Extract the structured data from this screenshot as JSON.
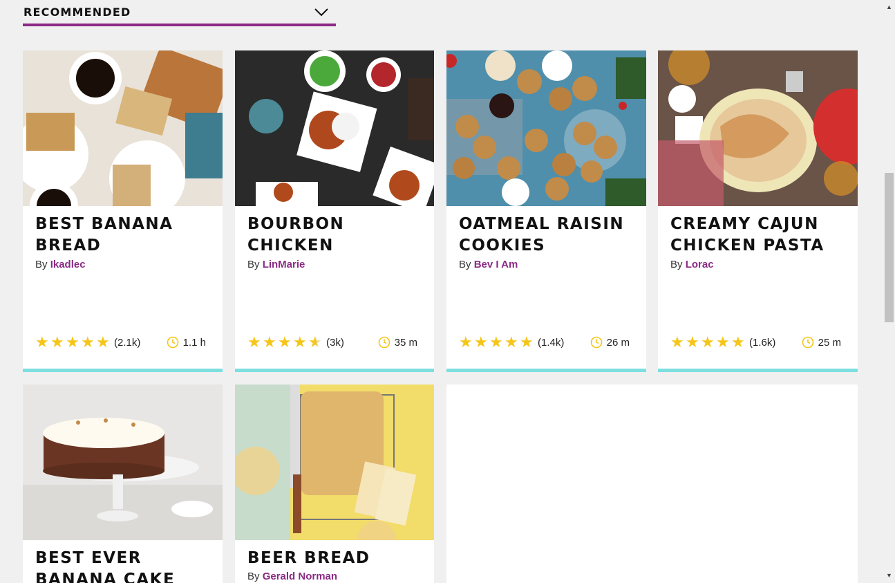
{
  "sort": {
    "label": "RECOMMENDED"
  },
  "by_prefix": "By",
  "recipes": [
    {
      "title": "BEST BANANA BREAD",
      "author": "Ikadlec",
      "rating_value": 5,
      "rating_count": "(2.1k)",
      "time": "1.1 h"
    },
    {
      "title": "BOURBON CHICKEN",
      "author": "LinMarie",
      "rating_value": 4.5,
      "rating_count": "(3k)",
      "time": "35 m"
    },
    {
      "title": "OATMEAL RAISIN COOKIES",
      "author": "Bev I Am",
      "rating_value": 5,
      "rating_count": "(1.4k)",
      "time": "26 m"
    },
    {
      "title": "CREAMY CAJUN CHICKEN PASTA",
      "author": "Lorac",
      "rating_value": 5,
      "rating_count": "(1.6k)",
      "time": "25 m"
    },
    {
      "title": "BEST EVER BANANA CAKE WITH CREAM",
      "author": ""
    },
    {
      "title": "BEER BREAD",
      "author": "Gerald Norman"
    }
  ],
  "colors": {
    "accent": "#8a2a84",
    "card_border": "#7ddfe0",
    "star": "#f5c518"
  },
  "icons": {
    "sort": "chevron-down-icon",
    "star": "star-icon",
    "clock": "clock-icon"
  }
}
